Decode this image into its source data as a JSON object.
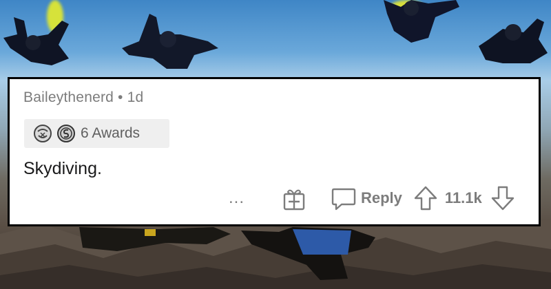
{
  "colors": {
    "card_border": "#000000",
    "meta_text": "#7c7c7c",
    "body_text": "#1a1a1b",
    "awards_bg": "#efefef"
  },
  "background": {
    "description_icons": [
      "skydiver-icon",
      "smoke-trail-icon"
    ]
  },
  "comment": {
    "author": "Baileythenerd",
    "separator": "•",
    "age": "1d",
    "awards": {
      "icons": [
        "hug-award-icon",
        "silver-coin-award-icon"
      ],
      "label": "6 Awards"
    },
    "body": "Skydiving.",
    "actions": {
      "more_label": "...",
      "gift_icon": "gift-icon",
      "reply_icon": "reply-bubble-icon",
      "reply_label": "Reply",
      "upvote_icon": "upvote-arrow-icon",
      "score": "11.1k",
      "downvote_icon": "downvote-arrow-icon"
    }
  }
}
